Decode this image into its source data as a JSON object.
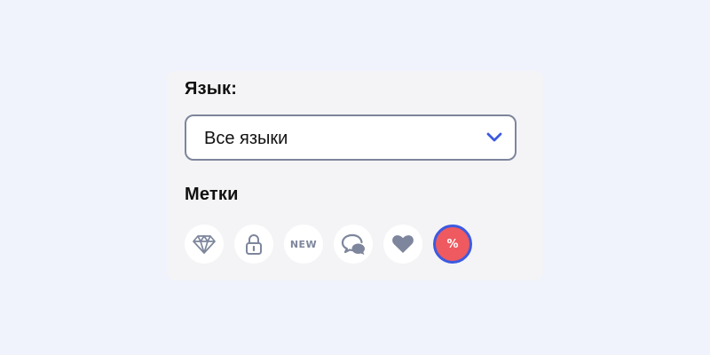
{
  "colors": {
    "page_background": "#f0f3fb",
    "panel_background": "#f4f4f6",
    "icon_gray": "#7d869c",
    "chevron_blue": "#3c5ae0",
    "active_tag_fill": "#ee5a5f",
    "active_tag_border": "#3c5ae0"
  },
  "language": {
    "label": "Язык:",
    "selected": "Все языки",
    "dropdown_icon": "chevron-down-icon"
  },
  "tags": {
    "label": "Метки",
    "items": [
      {
        "icon": "diamond-icon",
        "active": false
      },
      {
        "icon": "lock-icon",
        "active": false
      },
      {
        "icon": "new-badge-icon",
        "text": "NEW",
        "active": false
      },
      {
        "icon": "chat-bubbles-icon",
        "active": false
      },
      {
        "icon": "heart-icon",
        "active": false
      },
      {
        "icon": "percent-icon",
        "text": "%",
        "active": true
      }
    ]
  }
}
